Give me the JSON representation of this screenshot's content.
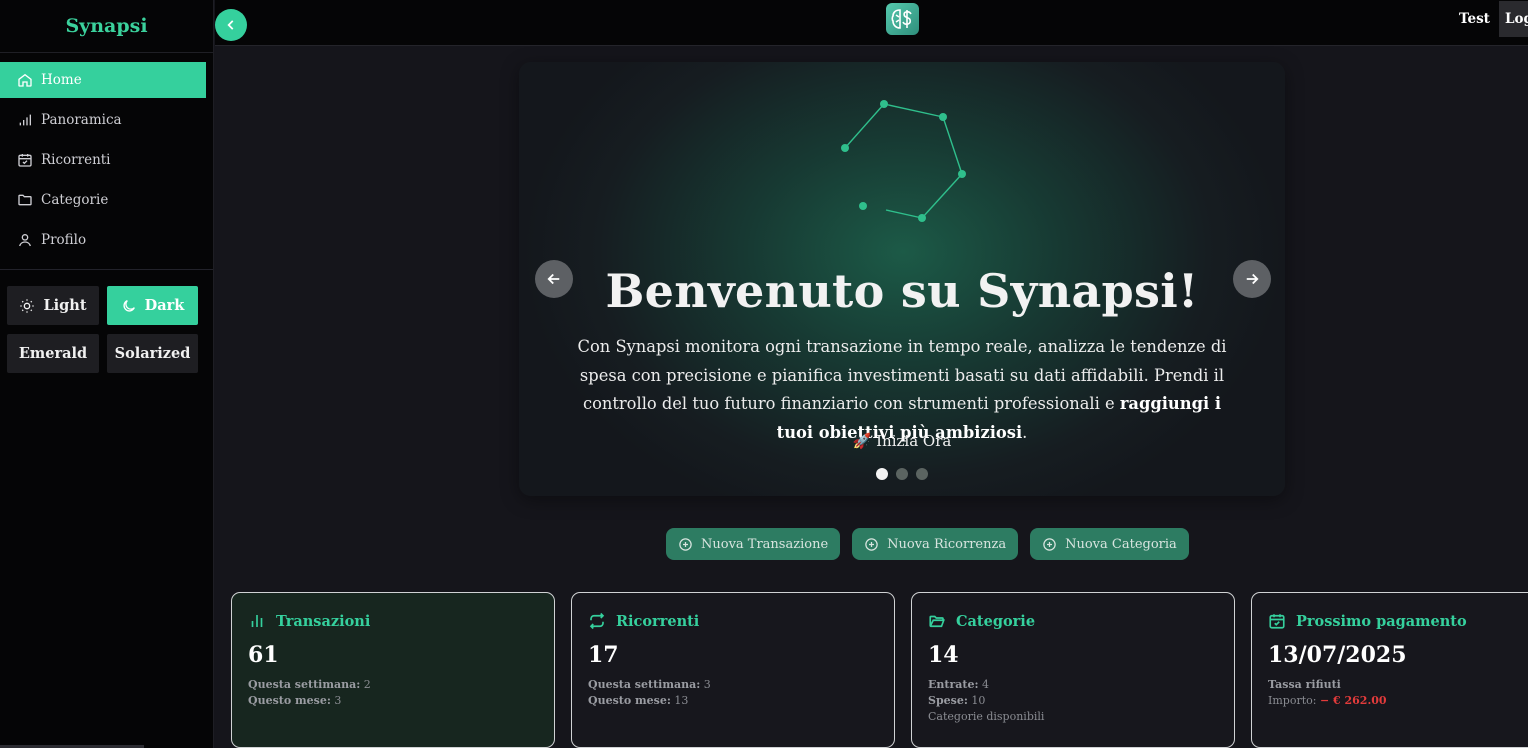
{
  "app": {
    "brand": "Synapsi"
  },
  "sidebar": {
    "items": [
      {
        "label": "Home",
        "icon": "home-icon",
        "active": true
      },
      {
        "label": "Panoramica",
        "icon": "bar-chart-icon"
      },
      {
        "label": "Ricorrenti",
        "icon": "calendar-check-icon"
      },
      {
        "label": "Categorie",
        "icon": "folder-icon"
      },
      {
        "label": "Profilo",
        "icon": "user-icon"
      }
    ],
    "themes": [
      {
        "label": "Light",
        "icon": "sun-icon"
      },
      {
        "label": "Dark",
        "icon": "moon-icon",
        "active": true
      },
      {
        "label": "Emerald"
      },
      {
        "label": "Solarized"
      }
    ]
  },
  "topbar": {
    "user": "Test",
    "logout_label": "Logout"
  },
  "hero": {
    "title": "Benvenuto su Synapsi!",
    "description_plain": "Con Synapsi monitora ogni transazione in tempo reale, analizza le tendenze di spesa con precisione e pianifica investimenti basati su dati affidabili. Prendi il controllo del tuo futuro finanziario con strumenti professionali e ",
    "description_bold": "raggiungi i tuoi obiettivi più ambiziosi",
    "description_end": ".",
    "cta_emoji": "🚀",
    "cta_label": "Inizia Ora",
    "slides_total": 3,
    "active_slide": 1
  },
  "actions": [
    {
      "label": "Nuova Transazione"
    },
    {
      "label": "Nuova Ricorrenza"
    },
    {
      "label": "Nuova Categoria"
    }
  ],
  "cards": {
    "transazioni": {
      "title": "Transazioni",
      "value": "61",
      "week_label": "Questa settimana:",
      "week_value": "2",
      "month_label": "Questo mese:",
      "month_value": "3"
    },
    "ricorrenti": {
      "title": "Ricorrenti",
      "value": "17",
      "week_label": "Questa settimana:",
      "week_value": "3",
      "month_label": "Questo mese:",
      "month_value": "13"
    },
    "categorie": {
      "title": "Categorie",
      "value": "14",
      "in_label": "Entrate:",
      "in_value": "4",
      "out_label": "Spese:",
      "out_value": "10",
      "note": "Categorie disponibili"
    },
    "pagamento": {
      "title": "Prossimo pagamento",
      "value": "13/07/2025",
      "name": "Tassa rifiuti",
      "amount_label": "Importo:",
      "amount_value": "− € 262.00"
    }
  },
  "colors": {
    "accent": "#35d09d",
    "negative": "#e23b3b",
    "background": "#15151b",
    "sidebar": "#050506"
  }
}
